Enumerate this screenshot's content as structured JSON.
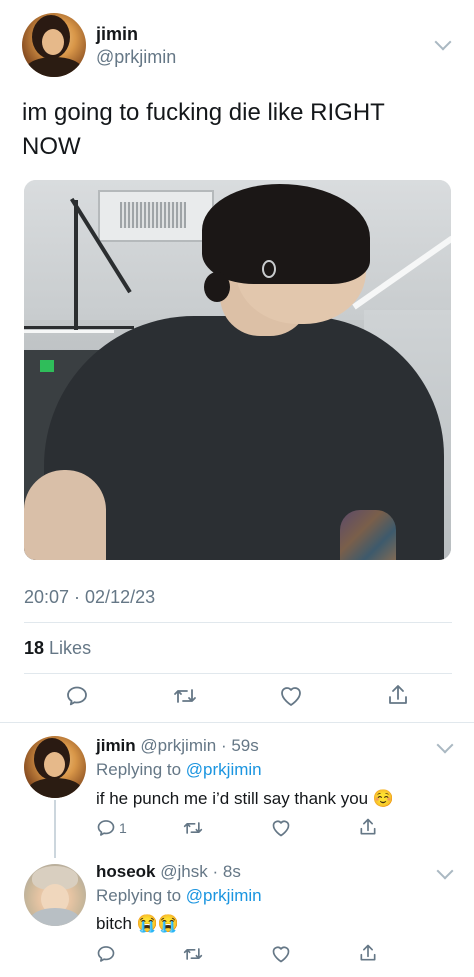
{
  "main_tweet": {
    "author_name": "jimin",
    "author_handle": "@prkjimin",
    "text_line1": "im going to fucking die like RIGHT",
    "text_line2": "NOW",
    "timestamp": "20:07 · 02/12/23",
    "likes_count": "18",
    "likes_label": "Likes",
    "actions": [
      "reply-icon",
      "retweet-icon",
      "like-icon",
      "share-icon"
    ]
  },
  "replies": [
    {
      "author_name": "jimin",
      "author_handle": "@prkjimin",
      "time": "59s",
      "replying_prefix": "Replying to",
      "replying_to": "@prkjimin",
      "text": "if he punch me i’d still say thank you",
      "emoji": "☺️",
      "reply_count": "1"
    },
    {
      "author_name": "hoseok",
      "author_handle": "@jhsk",
      "time": "8s",
      "replying_prefix": "Replying to",
      "replying_to": "@prkjimin",
      "text": "bitch",
      "emoji": "😭😭"
    }
  ],
  "colors": {
    "text": "#14171a",
    "secondary": "#657786",
    "link": "#1b95e0",
    "divider": "#e1e8ed",
    "icon": "#657786"
  }
}
